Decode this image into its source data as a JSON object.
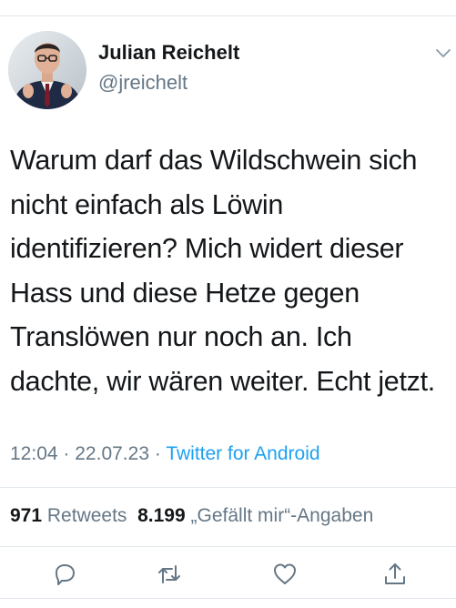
{
  "tweet": {
    "author": {
      "display_name": "Julian Reichelt",
      "handle": "@jreichelt"
    },
    "text_lines": [
      "Warum darf das Wildschwein sich",
      "nicht einfach als Löwin",
      "identifizieren? Mich widert dieser",
      "Hass und diese Hetze gegen",
      "Translöwen nur noch an. Ich",
      "dachte, wir wären weiter. Echt jetzt."
    ],
    "time": "12:04",
    "date": "22.07.23",
    "separator": "·",
    "source": "Twitter for Android",
    "retweet_count": "971",
    "retweet_label": "Retweets",
    "like_count": "8.199",
    "like_label": "„Gefällt mir“-Angaben"
  },
  "icons": {
    "caret": "chevron-down-icon",
    "reply": "reply-icon",
    "retweet": "retweet-icon",
    "like": "heart-icon",
    "share": "share-icon"
  },
  "colors": {
    "text": "#14171a",
    "secondary": "#657786",
    "link": "#1da1f2",
    "border": "#e1e8ed"
  }
}
